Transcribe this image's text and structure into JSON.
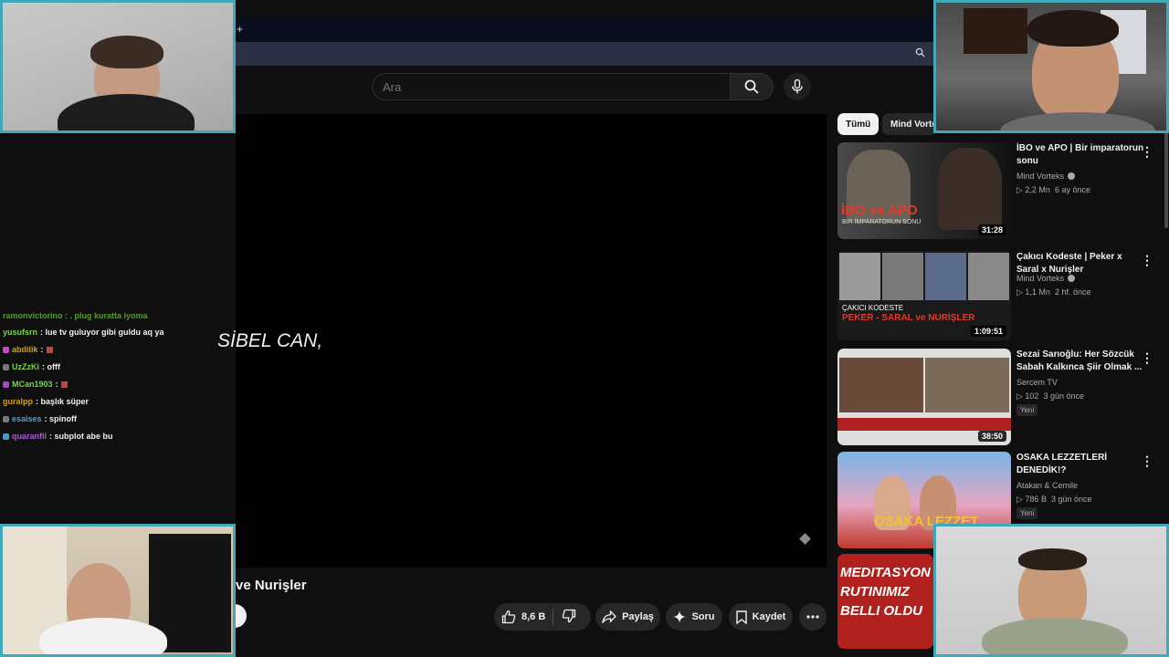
{
  "browser": {
    "new_tab_glyph": "+",
    "addr_search_icon": "search-icon"
  },
  "youtube": {
    "search": {
      "placeholder": "Ara"
    },
    "player": {
      "subtitle": "SİBEL CAN,"
    },
    "video": {
      "title_partial": "ve Nurişler"
    },
    "actions": {
      "likes": "8,6 B",
      "share": "Paylaş",
      "ask": "Soru",
      "save": "Kaydet"
    },
    "chips": [
      "Tümü",
      "Mind Vortek"
    ],
    "recommendations": [
      {
        "title": "İBO ve APO | Bir imparatorun sonu",
        "channel": "Mind Vorteks",
        "verified": true,
        "views": "2,2 Mn",
        "age": "6 ay önce",
        "duration": "31:28",
        "new": ""
      },
      {
        "title": "Çakıcı Kodeste | Peker x Saral  x Nurişler",
        "channel": "Mind Vorteks",
        "verified": true,
        "views": "1,1 Mn",
        "age": "2 hf. önce",
        "duration": "1:09:51",
        "new": ""
      },
      {
        "title": "Sezai Sarıoğlu: Her Sözcük Sabah Kalkınca Şiir Olmak ...",
        "channel": "Sercem TV",
        "verified": false,
        "views": "102",
        "age": "3 gün önce",
        "duration": "38:50",
        "new": "Yeni"
      },
      {
        "title": "OSAKA LEZZETLERİ DENEDİK!?",
        "channel": "Atakan & Cemile",
        "verified": false,
        "views": "786 B",
        "age": "3 gün önce",
        "duration": "",
        "new": "Yeni"
      }
    ],
    "thumb_texts": {
      "ibo_apo": "İBO ve APO",
      "ibo_apo_sub": "BİR İMPARATORUN SONU",
      "cakici_top": "ÇAKICI KODESTE",
      "cakici_bottom": "PEKER - SARAL ve NURİŞLER",
      "osaka": "OSAKA LEZZET",
      "meditasyon": "MEDITASYON RUTINIMIZ BELLI OLDU"
    }
  },
  "chat": {
    "messages": [
      {
        "user": "yusufsrn",
        "user_color": "#7ad14a",
        "text": ": lue tv guluyor gibi guldu aq ya",
        "badge": ""
      },
      {
        "user": "abdilik",
        "user_color": "#d4a017",
        "text": ":",
        "badge": "#c04cc0",
        "emote": true
      },
      {
        "user": "UzZzKi",
        "user_color": "#7ad14a",
        "text": ": offf",
        "badge": "#777777"
      },
      {
        "user": "MCan1903",
        "user_color": "#7ad14a",
        "text": ":",
        "badge": "#9c4cc0",
        "emote": true
      },
      {
        "user": "guralpp",
        "user_color": "#d4a017",
        "text": ": başlık süper",
        "badge": ""
      },
      {
        "user": "esaises",
        "user_color": "#4aa0d8",
        "text": ": spinoff",
        "badge": "#777777"
      },
      {
        "user": "quaranfil",
        "user_color": "#b05ad8",
        "text": ": subplot abe bu",
        "badge": "#3aa0d8"
      }
    ],
    "cut_line": "ramonvictorino : . plug kuratta iyoma"
  },
  "colors": {
    "cam_border": "#3ea9b8",
    "yt_bg": "#0f0f0f",
    "chip_active": "#f1f1f1"
  }
}
